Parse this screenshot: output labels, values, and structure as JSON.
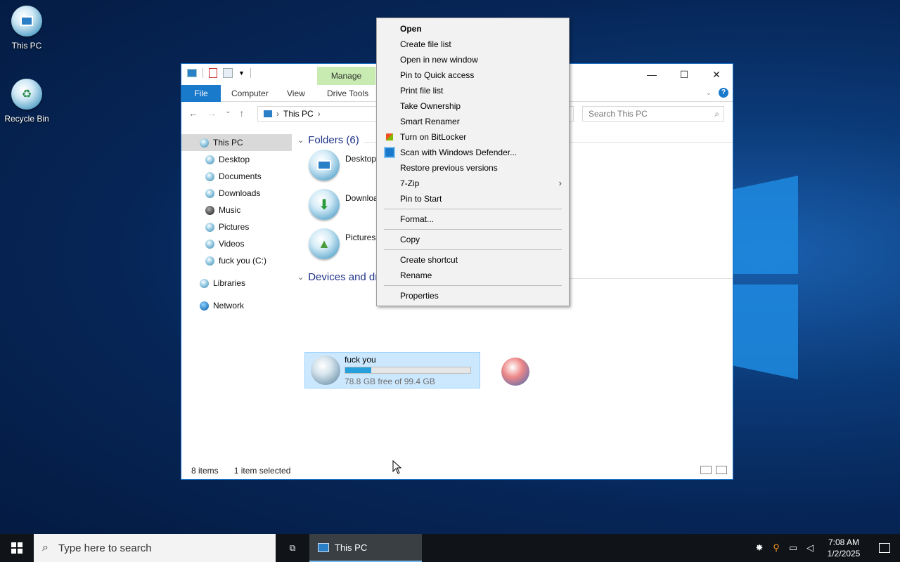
{
  "desktop": {
    "icons": [
      {
        "label": "This PC"
      },
      {
        "label": "Recycle Bin"
      }
    ]
  },
  "window": {
    "manage_tab": "Manage",
    "ribbon_tabs": [
      "File",
      "Computer",
      "View",
      "Drive Tools"
    ],
    "address": {
      "path": "This PC"
    },
    "search_placeholder": "Search This PC",
    "nav": {
      "this_pc": "This PC",
      "items": [
        "Desktop",
        "Documents",
        "Downloads",
        "Music",
        "Pictures",
        "Videos",
        "fuck you (C:)"
      ],
      "libraries": "Libraries",
      "network": "Network"
    },
    "content": {
      "folders_header": "Folders (6)",
      "folders": [
        "Desktop",
        "Downloa",
        "Pictures"
      ],
      "devices_header": "Devices and dr",
      "drive": {
        "name": "fuck you",
        "free_text": "78.8 GB free of 99.4 GB",
        "used_fraction": 0.207
      }
    },
    "status": {
      "items": "8 items",
      "selected": "1 item selected"
    }
  },
  "context_menu": {
    "items": [
      {
        "label": "Open",
        "bold": true
      },
      {
        "label": "Create file list"
      },
      {
        "label": "Open in new window"
      },
      {
        "label": "Pin to Quick access"
      },
      {
        "label": "Print file list"
      },
      {
        "label": "Take Ownership"
      },
      {
        "label": "Smart Renamer"
      },
      {
        "label": "Turn on BitLocker",
        "icon": "bitlocker-icon"
      },
      {
        "label": "Scan with Windows Defender...",
        "icon": "defender-icon"
      },
      {
        "label": "Restore previous versions"
      },
      {
        "label": "7-Zip",
        "submenu": true
      },
      {
        "label": "Pin to Start"
      },
      {
        "label": "Format..."
      },
      {
        "label": "Copy"
      },
      {
        "label": "Create shortcut"
      },
      {
        "label": "Rename"
      },
      {
        "label": "Properties"
      }
    ]
  },
  "taskbar": {
    "search_placeholder": "Type here to search",
    "app_button": "This PC",
    "time": "7:08 AM",
    "date": "1/2/2025"
  },
  "colors": {
    "accent": "#1979ca",
    "selection": "#cce8ff",
    "manage": "#c7ebb0"
  }
}
